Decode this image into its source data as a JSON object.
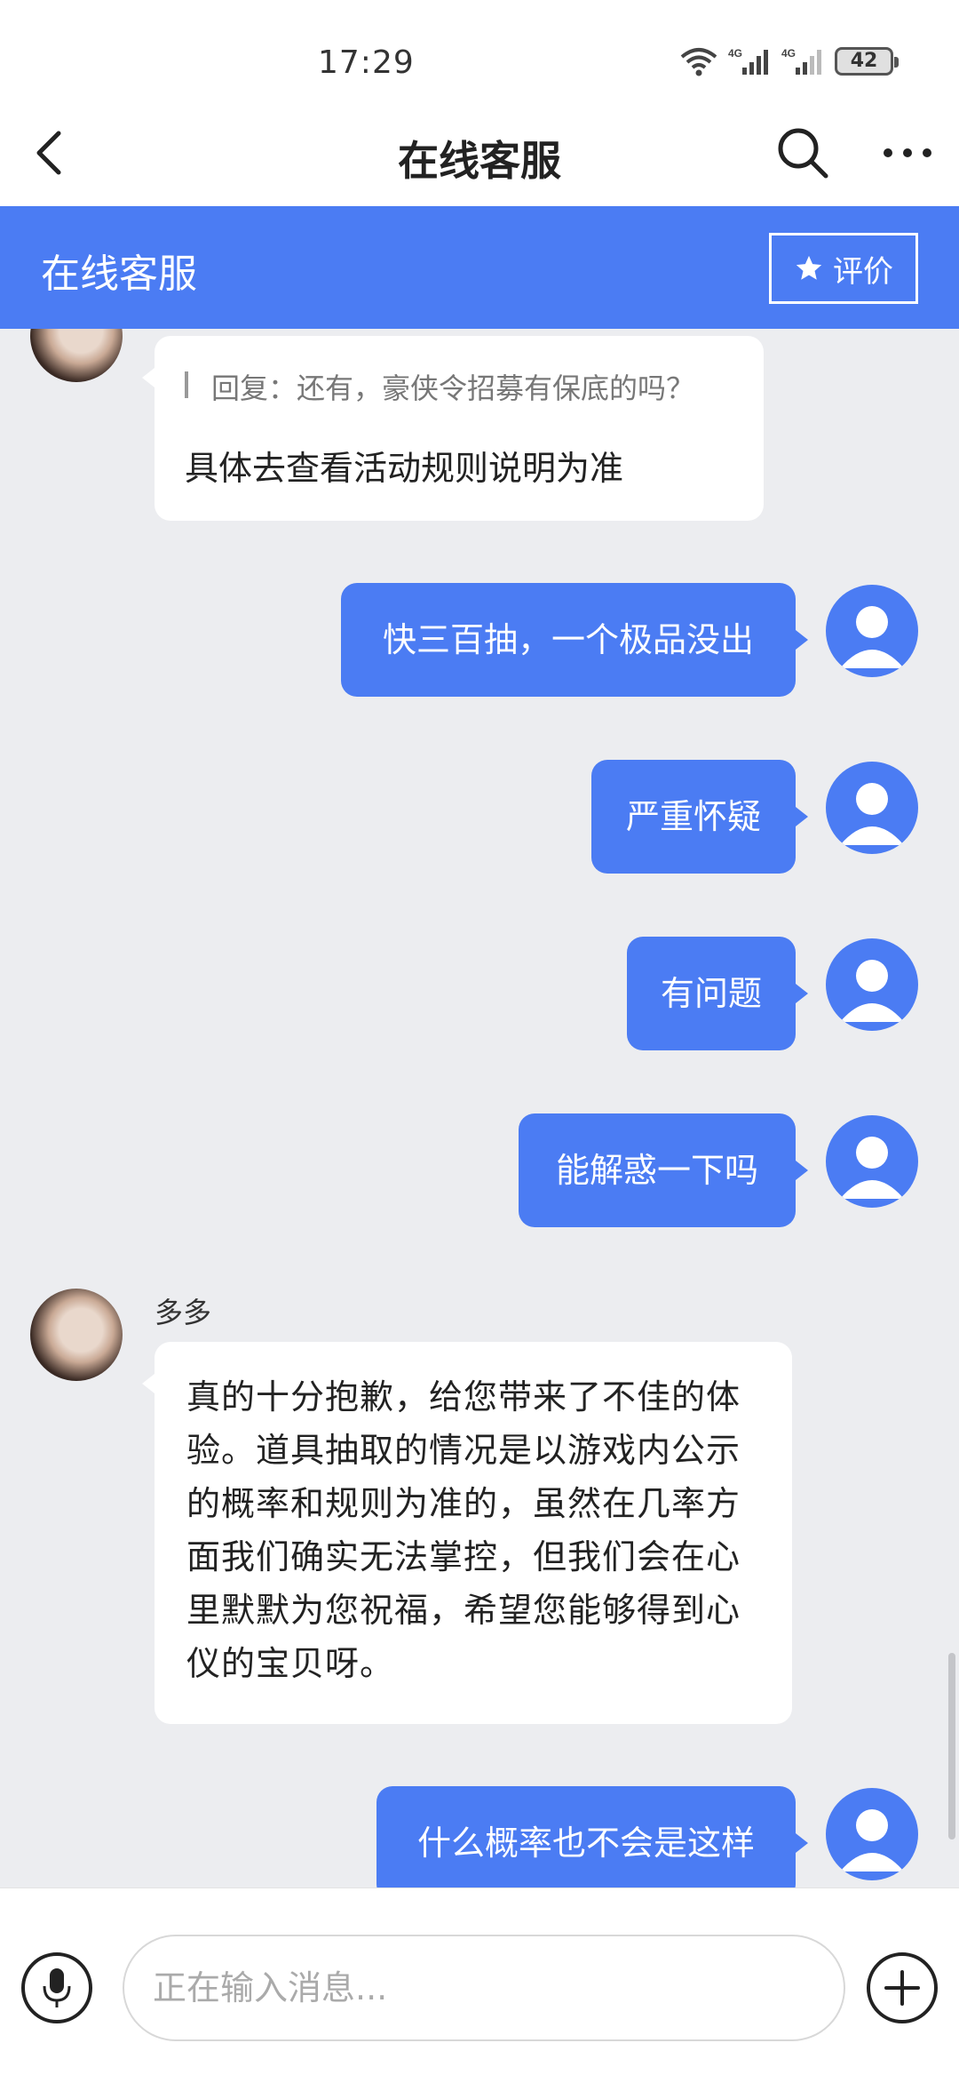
{
  "status_bar": {
    "time": "17:29",
    "battery": "42",
    "signal1": "4G",
    "signal2": "4G"
  },
  "nav": {
    "title": "在线客服",
    "back_icon": "chevron-left-icon",
    "search_icon": "search-icon",
    "more_icon": "more-dots-icon"
  },
  "header": {
    "title": "在线客服",
    "rate_label": "评价",
    "rate_icon": "star-icon"
  },
  "colors": {
    "accent": "#4b7cf3",
    "background": "#ecedf0",
    "bubble_in": "#ffffff"
  },
  "messages": {
    "reply": {
      "quote": "回复：还有，豪侠令招募有保底的吗？",
      "text": "具体去查看活动规则说明为准"
    },
    "user": [
      "快三百抽，一个极品没出",
      "严重怀疑",
      "有问题",
      "能解惑一下吗"
    ],
    "agent_name": "多多",
    "agent_long": [
      "真的十分抱歉，给您带来了不佳的体",
      "验。道具抽取的情况是以游戏内公示",
      "的概率和规则为准的，虽然在几率方",
      "面我们确实无法掌控，但我们会在心",
      "里默默为您祝福，希望您能够得到心",
      "仪的宝贝呀。"
    ],
    "user_last": "什么概率也不会是这样"
  },
  "input": {
    "placeholder": "正在输入消息...",
    "voice_icon": "microphone-icon",
    "plus_icon": "plus-icon"
  }
}
